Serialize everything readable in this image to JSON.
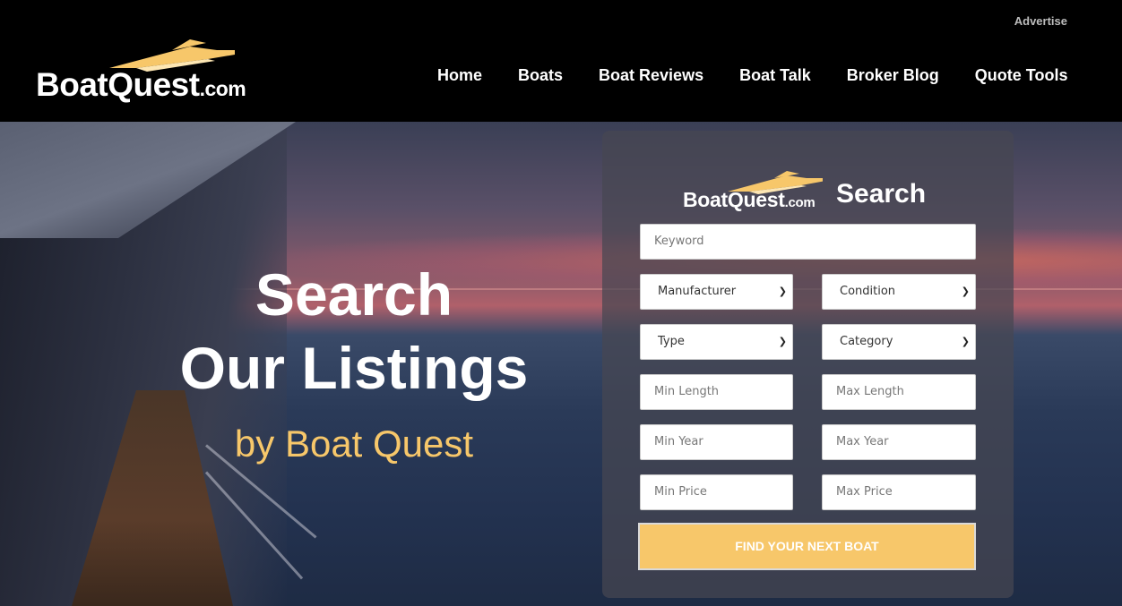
{
  "header": {
    "advertise": "Advertise",
    "logo": {
      "name": "BoatQuest",
      "suffix": ".com"
    },
    "nav": [
      "Home",
      "Boats",
      "Boat Reviews",
      "Boat Talk",
      "Broker Blog",
      "Quote Tools"
    ]
  },
  "hero": {
    "title_line1": "Search",
    "title_line2": "Our Listings",
    "subtitle": "by Boat Quest"
  },
  "search_panel": {
    "logo": {
      "name": "BoatQuest",
      "suffix": ".com"
    },
    "heading": "Search",
    "keyword_placeholder": "Keyword",
    "manufacturer": "Manufacturer",
    "condition": "Condition",
    "type": "Type",
    "category": "Category",
    "min_length_placeholder": "Min Length",
    "max_length_placeholder": "Max Length",
    "min_year_placeholder": "Min Year",
    "max_year_placeholder": "Max Year",
    "min_price_placeholder": "Min Price",
    "max_price_placeholder": "Max Price",
    "submit": "FIND YOUR NEXT BOAT"
  },
  "colors": {
    "accent": "#f7c76a",
    "header_bg": "#000000",
    "text_light": "#ffffff"
  }
}
